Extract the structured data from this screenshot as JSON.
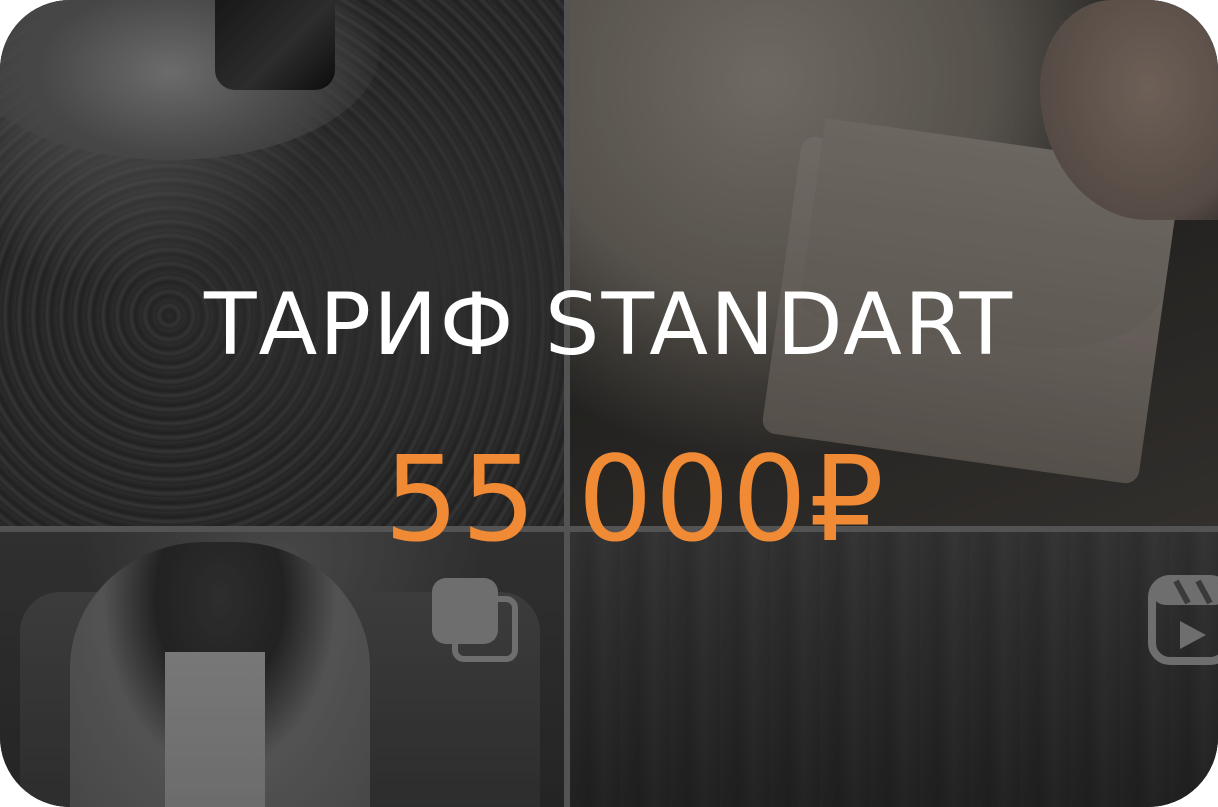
{
  "card": {
    "title": "ТАРИФ STANDART",
    "price": "55 000₽"
  },
  "tiles": [
    {
      "name": "tile-top-left"
    },
    {
      "name": "tile-top-right"
    },
    {
      "name": "tile-bottom-left",
      "badge_icon": "carousel-icon"
    },
    {
      "name": "tile-bottom-right",
      "badge_icon": "reels-icon"
    }
  ],
  "colors": {
    "title": "#ffffff",
    "price": "#f08a34",
    "divider": "#6b6b6b",
    "icon": "#6e6e6e"
  }
}
